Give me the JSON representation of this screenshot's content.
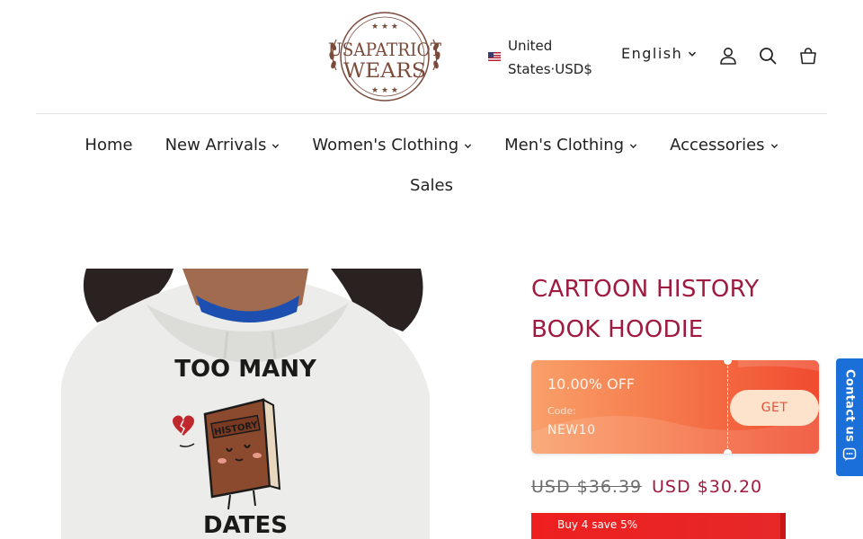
{
  "header": {
    "logo": {
      "line1": "USAPATRIOT",
      "line2": "WEARS"
    },
    "country": {
      "label": "United States·USD$"
    },
    "language": {
      "label": "English"
    },
    "icons": [
      "account-icon",
      "search-icon",
      "cart-icon"
    ]
  },
  "nav": {
    "items": [
      {
        "label": "Home",
        "has_dropdown": false
      },
      {
        "label": "New Arrivals",
        "has_dropdown": true
      },
      {
        "label": "Women's Clothing",
        "has_dropdown": true
      },
      {
        "label": "Men's Clothing",
        "has_dropdown": true
      },
      {
        "label": "Accessories",
        "has_dropdown": true
      },
      {
        "label": "Sales",
        "has_dropdown": false
      }
    ]
  },
  "product": {
    "image": {
      "text_top": "TOO MANY",
      "book_label": "HISTORY",
      "text_bottom": "DATES"
    },
    "title": "CARTOON HISTORY BOOK HOODIE",
    "coupon": {
      "discount": "10.00% OFF",
      "code_label": "Code:",
      "code": "NEW10",
      "button": "GET"
    },
    "price_old": "USD $36.39",
    "price_new": "USD $30.20",
    "bundle_offer": "Buy 4 save 5%"
  },
  "contact": {
    "label": "Contact us"
  },
  "colors": {
    "accent": "#a01a3f",
    "coupon_start": "#f9a06a",
    "coupon_end": "#f04b2f",
    "bundle": "#ee1f1f",
    "contact": "#1a6fd8",
    "logo": "#7a4a3a"
  }
}
